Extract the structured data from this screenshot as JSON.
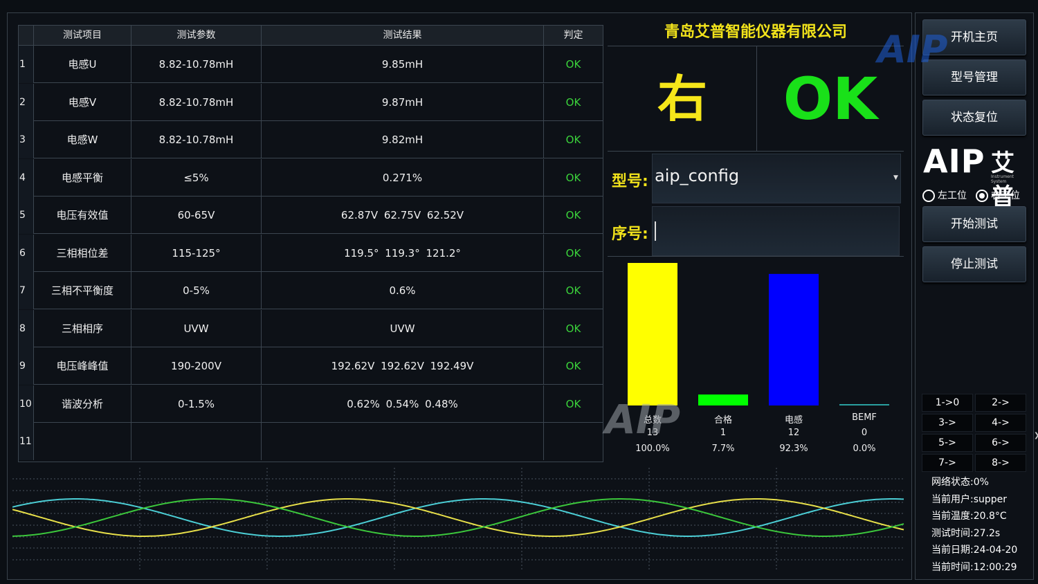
{
  "table": {
    "headers": [
      "测试项目",
      "测试参数",
      "测试结果",
      "判定"
    ],
    "rows": [
      {
        "idx": "1",
        "name": "电感U",
        "param": "8.82-10.78mH",
        "result": "9.85mH",
        "judge": "OK"
      },
      {
        "idx": "2",
        "name": "电感V",
        "param": "8.82-10.78mH",
        "result": "9.87mH",
        "judge": "OK"
      },
      {
        "idx": "3",
        "name": "电感W",
        "param": "8.82-10.78mH",
        "result": "9.82mH",
        "judge": "OK"
      },
      {
        "idx": "4",
        "name": "电感平衡",
        "param": "≤5%",
        "result": "0.271%",
        "judge": "OK"
      },
      {
        "idx": "5",
        "name": "电压有效值",
        "param": "60-65V",
        "result": "62.87V 62.75V 62.52V",
        "judge": "OK"
      },
      {
        "idx": "6",
        "name": "三相相位差",
        "param": "115-125°",
        "result": "119.5° 119.3° 121.2°",
        "judge": "OK"
      },
      {
        "idx": "7",
        "name": "三相不平衡度",
        "param": "0-5%",
        "result": "0.6%",
        "judge": "OK"
      },
      {
        "idx": "8",
        "name": "三相相序",
        "param": "UVW",
        "result": "UVW",
        "judge": "OK"
      },
      {
        "idx": "9",
        "name": "电压峰峰值",
        "param": "190-200V",
        "result": "192.62V 192.62V 192.49V",
        "judge": "OK"
      },
      {
        "idx": "10",
        "name": "谐波分析",
        "param": "0-1.5%",
        "result": "0.62% 0.54% 0.48%",
        "judge": "OK"
      },
      {
        "idx": "11",
        "name": "",
        "param": "",
        "result": "",
        "judge": ""
      }
    ]
  },
  "panel": {
    "company": "青岛艾普智能仪器有限公司",
    "station_result": "右",
    "overall_result": "OK",
    "model_label": "型号:",
    "model_value": "aip_config",
    "serial_label": "序号:",
    "serial_value": ""
  },
  "chart_data": {
    "type": "bar",
    "categories": [
      "总数",
      "合格",
      "电感",
      "BEMF"
    ],
    "values": [
      13,
      1,
      12,
      0
    ],
    "percents": [
      "100.0%",
      "7.7%",
      "92.3%",
      "0.0%"
    ],
    "colors": [
      "#ffff00",
      "#00ff00",
      "#0000ff",
      "#2aa0a0"
    ],
    "ylim": [
      0,
      13
    ]
  },
  "sidebar": {
    "buttons": [
      "开机主页",
      "型号管理",
      "状态复位"
    ],
    "test_buttons": [
      "开始测试",
      "停止测试"
    ],
    "logo_text": "AIP",
    "logo_cn": "艾普",
    "logo_sub": "Instrument System",
    "radio_left": "左工位",
    "radio_right": "右工位",
    "radio_selected": "右工位",
    "small_buttons": [
      "1->0",
      "2->",
      "3->",
      "4->",
      "5->",
      "6->",
      "7->",
      "8->"
    ],
    "status": [
      "网络状态:0%",
      "当前用户:supper",
      "当前温度:20.8°C",
      "测试时间:27.2s",
      "当前日期:24-04-20",
      "当前时间:12:00:29"
    ]
  },
  "watermark": "AIP",
  "colors": {
    "ok_green": "#19e119",
    "accent_yellow": "#f2e31b",
    "wave_yellow": "#e8e04a",
    "wave_green": "#3cc83c",
    "wave_cyan": "#4ccfd6"
  }
}
